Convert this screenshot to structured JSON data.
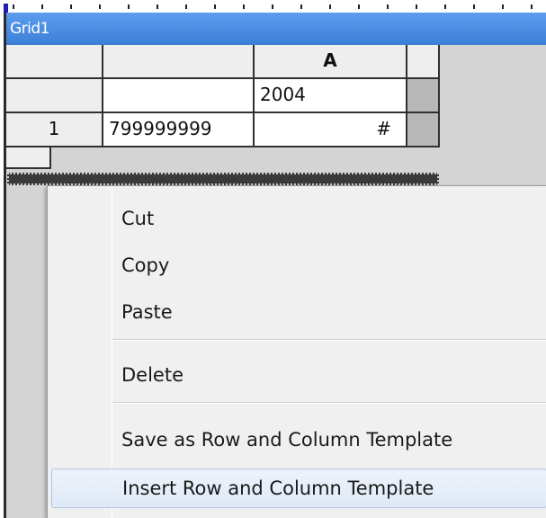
{
  "window": {
    "title": "Grid1"
  },
  "grid": {
    "column_header": "A",
    "row0_value": "2004",
    "row1": {
      "header": "1",
      "col_main": "799999999",
      "col_a": "#"
    }
  },
  "context_menu": {
    "items": [
      {
        "label": "Cut"
      },
      {
        "label": "Copy"
      },
      {
        "label": "Paste"
      },
      {
        "label": "Delete"
      },
      {
        "label": "Save as Row and Column Template"
      },
      {
        "label": "Insert Row and Column Template",
        "highlighted": true
      }
    ]
  },
  "colors": {
    "titlebar": "#3c7fd8",
    "menu_highlight": "#dfe9f7"
  }
}
